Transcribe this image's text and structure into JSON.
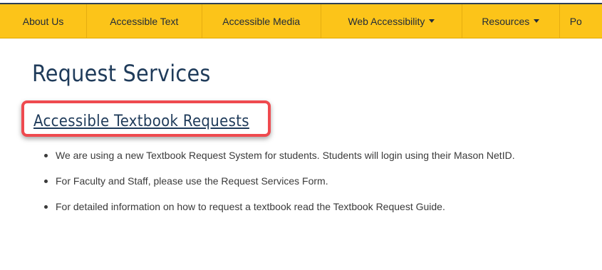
{
  "nav": {
    "items": [
      {
        "label": "About Us",
        "dropdown": false
      },
      {
        "label": "Accessible Text",
        "dropdown": false
      },
      {
        "label": "Accessible Media",
        "dropdown": false
      },
      {
        "label": "Web Accessibility",
        "dropdown": true
      },
      {
        "label": "Resources",
        "dropdown": true
      },
      {
        "label": "Po",
        "dropdown": false
      }
    ]
  },
  "main": {
    "title": "Request Services",
    "section_link": "Accessible Textbook Requests",
    "bullets": [
      "We are using a new Textbook Request System for students. Students will login using their Mason NetID.",
      "For Faculty and Staff, please use the Request Services Form.",
      "For detailed information on how to request a textbook read the Textbook Request Guide."
    ]
  },
  "colors": {
    "navbar": "#fcc419",
    "title": "#1f3b5a",
    "highlight": "#ef4a4f"
  }
}
